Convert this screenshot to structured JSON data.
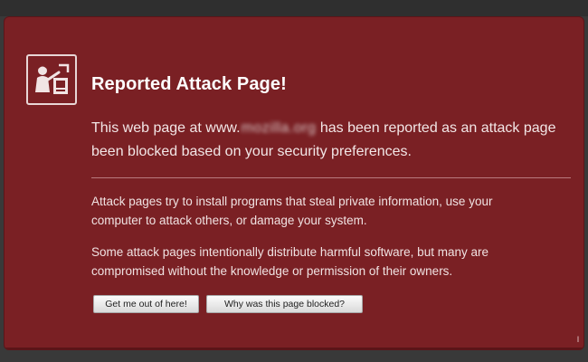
{
  "warning": {
    "title": "Reported Attack Page!",
    "intro_line1_before": "This web page at www.",
    "intro_blurred_domain": "mozilla.org",
    "intro_line1_after": " has been reported as an attack page",
    "intro_line2": "been blocked based on your security preferences.",
    "para1_line1": "Attack pages try to install programs that steal private information, use your",
    "para1_line2": "computer to attack others, or damage your system.",
    "para2_line1": "Some attack pages intentionally distribute harmful software, but many are",
    "para2_line2": "compromised without the knowledge or permission of their owners.",
    "icon": "attack-warning-icon"
  },
  "buttons": {
    "get_me_out_label": "Get me out of here!",
    "why_blocked_label": "Why was this page blocked?"
  },
  "colors": {
    "panel_background": "#7a2024",
    "title_text": "#ffffff",
    "body_text": "#f2e6e6",
    "outer_background": "#393939"
  }
}
